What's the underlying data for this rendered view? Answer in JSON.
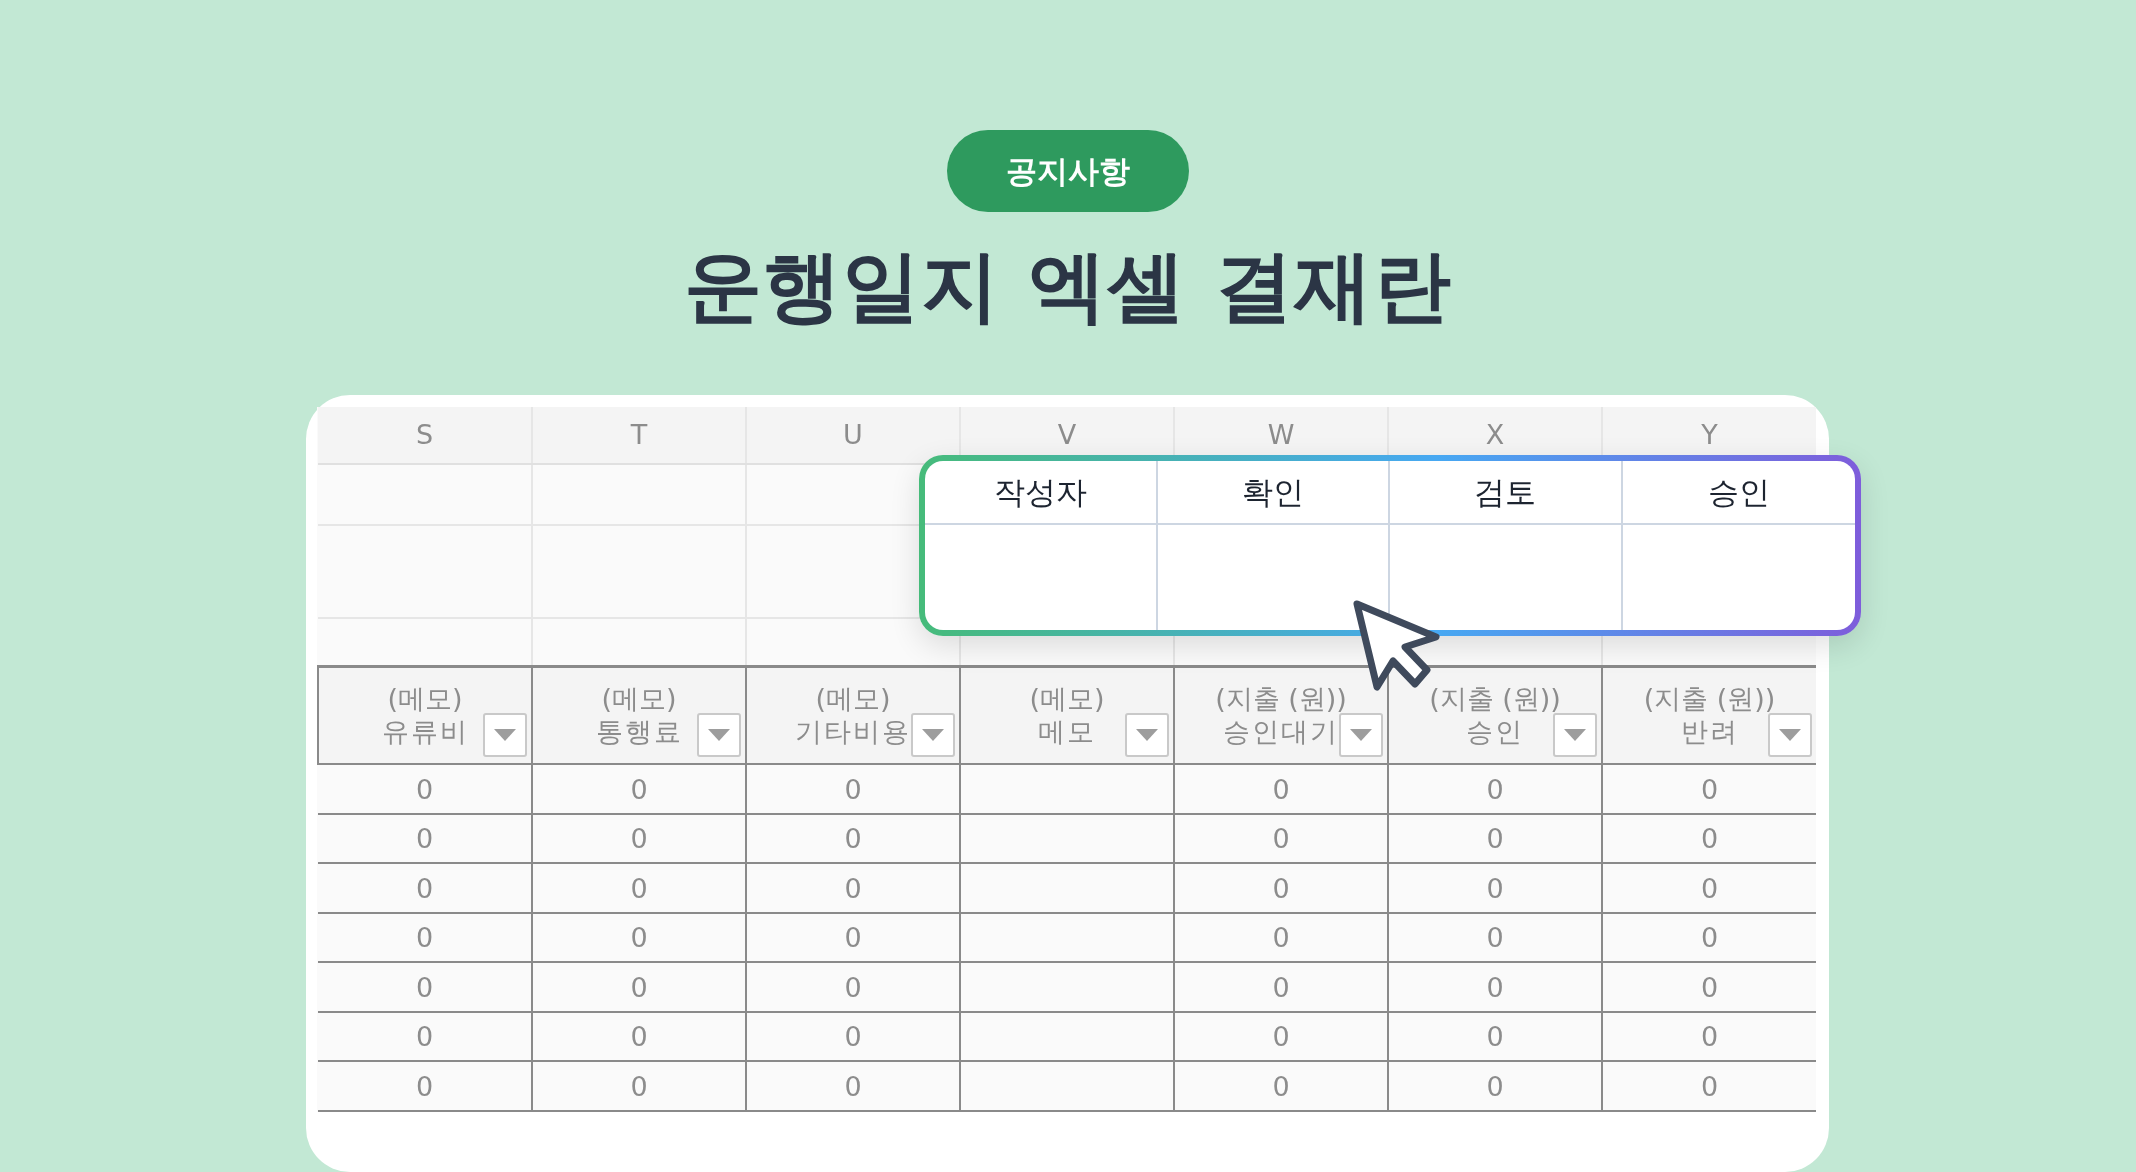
{
  "badge": "공지사항",
  "title": "운행일지 엑셀 결재란",
  "sheet": {
    "column_letters": [
      "S",
      "T",
      "U",
      "V",
      "W",
      "X",
      "Y"
    ],
    "headers": [
      {
        "group": "(메모)",
        "label": "유류비"
      },
      {
        "group": "(메모)",
        "label": "통행료"
      },
      {
        "group": "(메모)",
        "label": "기타비용"
      },
      {
        "group": "(메모)",
        "label": "메모"
      },
      {
        "group": "(지출 (원))",
        "label": "승인대기"
      },
      {
        "group": "(지출 (원))",
        "label": "승인"
      },
      {
        "group": "(지출 (원))",
        "label": "반려"
      }
    ],
    "rows": [
      [
        "0",
        "0",
        "0",
        null,
        "0",
        "0",
        "0"
      ],
      [
        "0",
        "0",
        "0",
        null,
        "0",
        "0",
        "0"
      ],
      [
        "0",
        "0",
        "0",
        null,
        "0",
        "0",
        "0"
      ],
      [
        "0",
        "0",
        "0",
        null,
        "0",
        "0",
        "0"
      ],
      [
        "0",
        "0",
        "0",
        null,
        "0",
        "0",
        "0"
      ],
      [
        "0",
        "0",
        "0",
        null,
        "0",
        "0",
        "0"
      ],
      [
        "0",
        "0",
        "0",
        null,
        "0",
        "0",
        "0"
      ]
    ]
  },
  "approval_box": {
    "columns": [
      "작성자",
      "확인",
      "검토",
      "승인"
    ]
  }
}
